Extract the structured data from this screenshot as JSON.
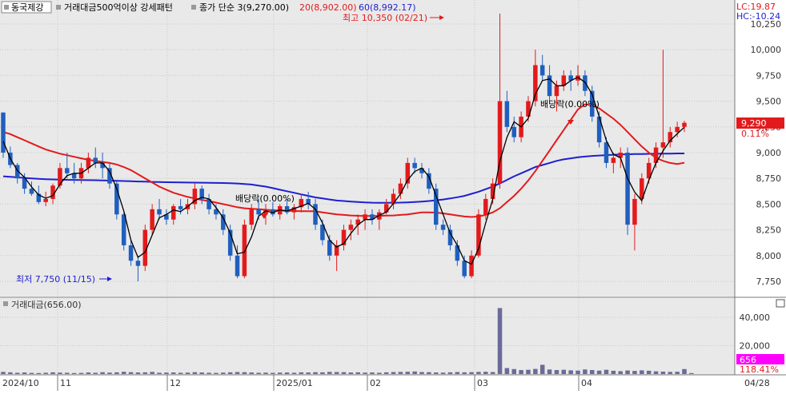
{
  "header": {
    "stock_name": "동국제강",
    "condition": "거래대금500억이상 강세패턴",
    "ma3_label": "종가 단순 3(9,270.00)",
    "ma20_label": "20(8,902.00)",
    "ma60_label": "60(8,992.17)",
    "lc_label": "LC:19.87",
    "hc_label": "HC:-10.24"
  },
  "annotations": {
    "high_label": "최고 10,350 (02/21)",
    "low_label": "최저 7,750 (11/15)",
    "dividend_1": "배당락(0.00%)",
    "dividend_2": "배당락(0.00%)"
  },
  "price_tag": {
    "price": "9,290",
    "change": "0.11%"
  },
  "volume_panel": {
    "label": "거래대금(656.00)",
    "current_value": "656",
    "current_pct": "118.41%"
  },
  "colors": {
    "up": "#e31a1c",
    "down": "#1f5fbf",
    "ma3": "#000000",
    "ma20": "#e31a1c",
    "ma60": "#1f1fcf",
    "volume": "#6b6b9a",
    "panel_bg": "#e9e9e9",
    "tag_price": "#e31a1c",
    "tag_volume": "#ff00ff"
  },
  "chart_data": [
    {
      "type": "candlestick",
      "title": "동국제강",
      "x_axis_labels": [
        "2024/10",
        "11",
        "12",
        "2025/01",
        "02",
        "03",
        "04",
        "04/28"
      ],
      "y_axis_labels": [
        "7,750",
        "8,000",
        "8,250",
        "8,500",
        "8,750",
        "9,000",
        "9,250",
        "9,500",
        "9,750",
        "10,000",
        "10,250"
      ],
      "ylim": [
        7650,
        10350
      ],
      "grid": true,
      "candles_ohlc": [
        [
          9390,
          9390,
          8950,
          9000
        ],
        [
          9000,
          9060,
          8850,
          8880
        ],
        [
          8880,
          8900,
          8700,
          8750
        ],
        [
          8750,
          8800,
          8600,
          8650
        ],
        [
          8650,
          8720,
          8580,
          8600
        ],
        [
          8600,
          8680,
          8500,
          8520
        ],
        [
          8520,
          8620,
          8480,
          8550
        ],
        [
          8550,
          8700,
          8500,
          8680
        ],
        [
          8680,
          8900,
          8650,
          8850
        ],
        [
          8850,
          9000,
          8750,
          8800
        ],
        [
          8800,
          8900,
          8700,
          8750
        ],
        [
          8750,
          8900,
          8700,
          8850
        ],
        [
          8850,
          9000,
          8800,
          8950
        ],
        [
          8950,
          9050,
          8850,
          8900
        ],
        [
          8900,
          9000,
          8750,
          8850
        ],
        [
          8850,
          8900,
          8650,
          8700
        ],
        [
          8700,
          8720,
          8350,
          8400
        ],
        [
          8400,
          8420,
          8050,
          8100
        ],
        [
          8100,
          8150,
          7900,
          7950
        ],
        [
          7950,
          8000,
          7750,
          7900
        ],
        [
          7900,
          8300,
          7850,
          8250
        ],
        [
          8250,
          8500,
          8200,
          8450
        ],
        [
          8450,
          8550,
          8350,
          8400
        ],
        [
          8400,
          8450,
          8300,
          8350
        ],
        [
          8350,
          8500,
          8300,
          8480
        ],
        [
          8480,
          8550,
          8400,
          8450
        ],
        [
          8450,
          8550,
          8400,
          8500
        ],
        [
          8500,
          8700,
          8450,
          8650
        ],
        [
          8650,
          8680,
          8500,
          8550
        ],
        [
          8550,
          8600,
          8400,
          8450
        ],
        [
          8450,
          8500,
          8350,
          8400
        ],
        [
          8400,
          8450,
          8200,
          8250
        ],
        [
          8250,
          8300,
          7950,
          8000
        ],
        [
          8000,
          8100,
          7780,
          7800
        ],
        [
          7800,
          8350,
          7780,
          8300
        ],
        [
          8300,
          8500,
          8250,
          8450
        ],
        [
          8450,
          8550,
          8350,
          8400
        ],
        [
          8400,
          8500,
          8300,
          8450
        ],
        [
          8450,
          8520,
          8380,
          8400
        ],
        [
          8400,
          8500,
          8350,
          8480
        ],
        [
          8480,
          8550,
          8400,
          8420
        ],
        [
          8420,
          8500,
          8350,
          8470
        ],
        [
          8470,
          8600,
          8420,
          8550
        ],
        [
          8550,
          8620,
          8450,
          8500
        ],
        [
          8500,
          8550,
          8250,
          8300
        ],
        [
          8300,
          8350,
          8100,
          8150
        ],
        [
          8150,
          8200,
          7950,
          8000
        ],
        [
          8000,
          8150,
          7850,
          8100
        ],
        [
          8100,
          8300,
          8050,
          8250
        ],
        [
          8250,
          8350,
          8150,
          8300
        ],
        [
          8300,
          8400,
          8200,
          8350
        ],
        [
          8350,
          8450,
          8250,
          8400
        ],
        [
          8400,
          8450,
          8300,
          8350
        ],
        [
          8350,
          8450,
          8250,
          8420
        ],
        [
          8420,
          8550,
          8400,
          8500
        ],
        [
          8500,
          8650,
          8450,
          8600
        ],
        [
          8600,
          8750,
          8550,
          8700
        ],
        [
          8700,
          8950,
          8650,
          8900
        ],
        [
          8900,
          8950,
          8800,
          8850
        ],
        [
          8850,
          8900,
          8750,
          8800
        ],
        [
          8800,
          8850,
          8600,
          8650
        ],
        [
          8650,
          8700,
          8250,
          8300
        ],
        [
          8300,
          8350,
          8200,
          8250
        ],
        [
          8250,
          8300,
          8050,
          8100
        ],
        [
          8100,
          8150,
          7900,
          7950
        ],
        [
          7950,
          8000,
          7780,
          7800
        ],
        [
          7800,
          8050,
          7780,
          8000
        ],
        [
          8000,
          8450,
          7980,
          8400
        ],
        [
          8400,
          8600,
          8350,
          8550
        ],
        [
          8550,
          8750,
          8500,
          8700
        ],
        [
          8700,
          10350,
          8650,
          9500
        ],
        [
          9500,
          9600,
          9200,
          9250
        ],
        [
          9250,
          9350,
          9100,
          9150
        ],
        [
          9150,
          9400,
          9100,
          9350
        ],
        [
          9350,
          9550,
          9300,
          9500
        ],
        [
          9500,
          10000,
          9450,
          9850
        ],
        [
          9850,
          9950,
          9700,
          9750
        ],
        [
          9750,
          9850,
          9500,
          9550
        ],
        [
          9550,
          9700,
          9400,
          9650
        ],
        [
          9650,
          9800,
          9600,
          9750
        ],
        [
          9750,
          9800,
          9600,
          9700
        ],
        [
          9700,
          9850,
          9650,
          9750
        ],
        [
          9750,
          9800,
          9550,
          9600
        ],
        [
          9600,
          9650,
          9300,
          9350
        ],
        [
          9350,
          9400,
          9050,
          9100
        ],
        [
          9100,
          9150,
          8850,
          8900
        ],
        [
          8900,
          9000,
          8800,
          8950
        ],
        [
          8950,
          9050,
          8850,
          9000
        ],
        [
          9000,
          9050,
          8200,
          8300
        ],
        [
          8300,
          8600,
          8050,
          8550
        ],
        [
          8550,
          8800,
          8500,
          8750
        ],
        [
          8750,
          8950,
          8700,
          8900
        ],
        [
          8900,
          9100,
          8850,
          9050
        ],
        [
          9050,
          10000,
          8950,
          9100
        ],
        [
          9100,
          9250,
          9050,
          9200
        ],
        [
          9200,
          9300,
          9150,
          9250
        ],
        [
          9250,
          9310,
          9200,
          9290
        ]
      ],
      "series": [
        {
          "name": "종가 단순 3",
          "values": [
            9110,
            8943,
            8827,
            8760,
            8667,
            8590,
            8557,
            8583,
            8693,
            8777,
            8800,
            8800,
            8850,
            8900,
            8900,
            8817,
            8650,
            8433,
            8150,
            7983,
            8033,
            8200,
            8367,
            8400,
            8443,
            8427,
            8477,
            8533,
            8567,
            8550,
            8467,
            8367,
            8217,
            8017,
            8033,
            8183,
            8383,
            8433,
            8417,
            8443,
            8433,
            8457,
            8480,
            8507,
            8450,
            8317,
            8150,
            8083,
            8117,
            8217,
            8300,
            8350,
            8350,
            8390,
            8423,
            8507,
            8600,
            8733,
            8817,
            8850,
            8767,
            8583,
            8400,
            8217,
            8100,
            7950,
            7917,
            8067,
            8317,
            8550,
            8917,
            9150,
            9300,
            9250,
            9333,
            9567,
            9700,
            9717,
            9650,
            9650,
            9700,
            9733,
            9683,
            9567,
            9350,
            9117,
            8983,
            8950,
            8750,
            8617,
            8533,
            8733,
            8900,
            9017,
            9117,
            9183,
            9247
          ]
        },
        {
          "name": "20",
          "values": [
            9200,
            9180,
            9150,
            9120,
            9090,
            9060,
            9030,
            9010,
            8990,
            8975,
            8960,
            8945,
            8930,
            8920,
            8910,
            8900,
            8885,
            8860,
            8830,
            8790,
            8750,
            8710,
            8670,
            8640,
            8610,
            8590,
            8570,
            8555,
            8540,
            8530,
            8515,
            8500,
            8485,
            8470,
            8460,
            8455,
            8450,
            8445,
            8440,
            8438,
            8435,
            8433,
            8432,
            8432,
            8430,
            8420,
            8410,
            8400,
            8395,
            8390,
            8387,
            8385,
            8385,
            8386,
            8388,
            8390,
            8395,
            8400,
            8410,
            8420,
            8420,
            8418,
            8410,
            8400,
            8390,
            8380,
            8375,
            8380,
            8395,
            8420,
            8460,
            8520,
            8580,
            8650,
            8730,
            8820,
            8920,
            9020,
            9120,
            9220,
            9320,
            9420,
            9470,
            9460,
            9430,
            9380,
            9330,
            9270,
            9200,
            9130,
            9060,
            9000,
            8950,
            8920,
            8900,
            8890,
            8902
          ]
        },
        {
          "name": "60",
          "values": [
            8770,
            8765,
            8760,
            8755,
            8750,
            8745,
            8742,
            8740,
            8738,
            8736,
            8735,
            8734,
            8733,
            8732,
            8730,
            8728,
            8726,
            8724,
            8722,
            8720,
            8718,
            8716,
            8714,
            8713,
            8712,
            8711,
            8710,
            8709,
            8708,
            8707,
            8706,
            8705,
            8703,
            8700,
            8695,
            8690,
            8680,
            8670,
            8655,
            8640,
            8625,
            8610,
            8595,
            8580,
            8565,
            8555,
            8545,
            8535,
            8530,
            8525,
            8520,
            8516,
            8514,
            8513,
            8513,
            8514,
            8515,
            8517,
            8520,
            8525,
            8530,
            8537,
            8545,
            8555,
            8567,
            8580,
            8600,
            8620,
            8645,
            8670,
            8700,
            8735,
            8770,
            8800,
            8830,
            8860,
            8880,
            8900,
            8920,
            8935,
            8945,
            8955,
            8962,
            8968,
            8972,
            8976,
            8980,
            8982,
            8984,
            8986,
            8987,
            8988,
            8989,
            8990,
            8991,
            8992,
            8992
          ]
        }
      ],
      "volume": {
        "label": "거래대금",
        "y_axis_labels": [
          "20,000",
          "40,000"
        ],
        "values": [
          1500,
          1200,
          900,
          1100,
          800,
          700,
          900,
          1200,
          1000,
          900,
          700,
          800,
          1100,
          900,
          1300,
          1000,
          1200,
          1600,
          1300,
          1100,
          1200,
          1500,
          900,
          1000,
          1100,
          900,
          1000,
          1300,
          1100,
          900,
          800,
          1000,
          1200,
          1400,
          1300,
          1100,
          900,
          1000,
          800,
          1000,
          1100,
          900,
          1200,
          1100,
          1300,
          1200,
          1500,
          1400,
          1300,
          1100,
          1200,
          1000,
          1100,
          900,
          1200,
          1400,
          1500,
          1600,
          1800,
          1400,
          1300,
          1100,
          1000,
          1200,
          1400,
          1200,
          1300,
          1500,
          1600,
          1400,
          46500,
          4200,
          3500,
          2800,
          3000,
          3600,
          6500,
          3200,
          2800,
          3000,
          2600,
          2400,
          3200,
          2800,
          2400,
          3000,
          2300,
          2000,
          2500,
          2200,
          2600,
          2300,
          1900,
          1700,
          1500,
          1600,
          3500,
          656
        ]
      }
    }
  ]
}
